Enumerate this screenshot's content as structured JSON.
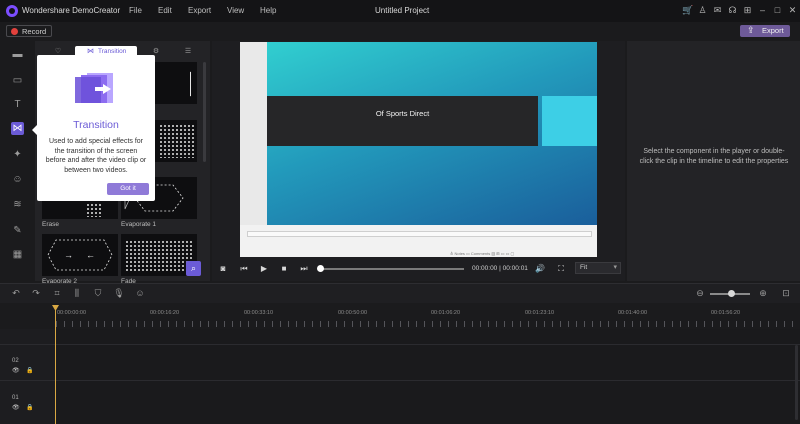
{
  "titlebar": {
    "app_name": "Wondershare DemoCreator",
    "menus": [
      "File",
      "Edit",
      "Export",
      "View",
      "Help"
    ],
    "project_title": "Untitled Project",
    "icons": [
      "cart-icon",
      "person-icon",
      "mail-icon",
      "headset-icon",
      "grid-icon",
      "minimize-icon",
      "maximize-icon",
      "close-icon"
    ]
  },
  "toolbar": {
    "record_label": "Record",
    "export_label": "Export"
  },
  "rail": {
    "icons": [
      "folder-icon",
      "caption-icon",
      "text-icon",
      "transition-icon",
      "magic-wand-icon",
      "sticker-icon",
      "audio-wave-icon",
      "pin-icon",
      "store-icon"
    ],
    "active": "transition-icon"
  },
  "library": {
    "active_tab": "Transition",
    "items": [
      {
        "label": "Erase"
      },
      {
        "label": "Evaporate 1"
      },
      {
        "label": "Evaporate 2"
      },
      {
        "label": "Fade"
      }
    ]
  },
  "popup": {
    "title": "Transition",
    "description": "Used to add special effects for the transition of the screen before and after the video clip or between two videos.",
    "button": "Got it"
  },
  "player": {
    "slide_text": "Of Sports Direct",
    "time_current": "00:00:00",
    "time_total": "00:00:01",
    "fit": "Fit",
    "statusbar_text": "≜ Notes   ▭ Comments   ▥   ⊞   ▭   ▭   ▢"
  },
  "properties": {
    "message": "Select the component in the player or double-click the clip in the timeline to edit the properties"
  },
  "timeline": {
    "ticks": [
      "00:00:00:00",
      "00:00:16:20",
      "00:00:33:10",
      "00:00:50:00",
      "00:01:06:20",
      "00:01:23:10",
      "00:01:40:00",
      "00:01:56:20"
    ],
    "tracks": [
      {
        "number": "02"
      },
      {
        "number": "01"
      }
    ]
  }
}
